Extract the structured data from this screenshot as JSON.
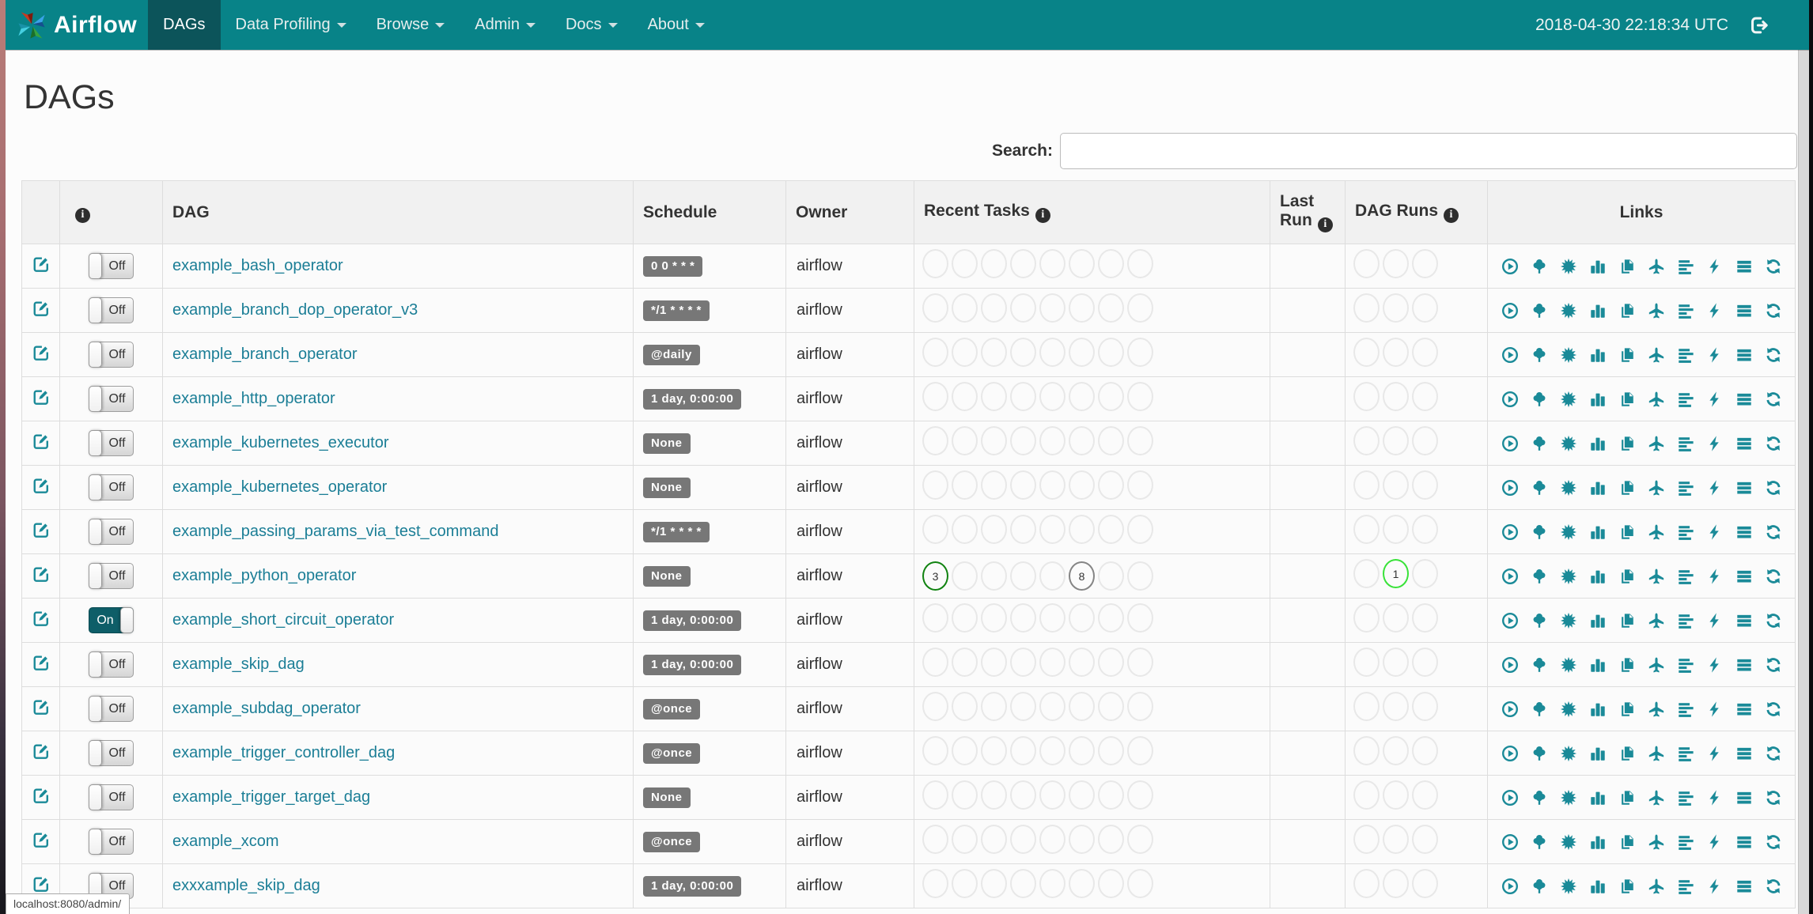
{
  "navbar": {
    "brand": "Airflow",
    "menu": [
      {
        "label": "DAGs",
        "active": true,
        "caret": false
      },
      {
        "label": "Data Profiling",
        "active": false,
        "caret": true
      },
      {
        "label": "Browse",
        "active": false,
        "caret": true
      },
      {
        "label": "Admin",
        "active": false,
        "caret": true
      },
      {
        "label": "Docs",
        "active": false,
        "caret": true
      },
      {
        "label": "About",
        "active": false,
        "caret": true
      }
    ],
    "clock": "2018-04-30 22:18:34 UTC"
  },
  "page": {
    "title": "DAGs",
    "search_label": "Search:",
    "search_value": "",
    "status_bar_url": "localhost:8080/admin/"
  },
  "table": {
    "headers": [
      {
        "label": "",
        "info": false
      },
      {
        "label": "",
        "info": true
      },
      {
        "label": "DAG",
        "info": false
      },
      {
        "label": "Schedule",
        "info": false
      },
      {
        "label": "Owner",
        "info": false
      },
      {
        "label": "Recent Tasks",
        "info": true
      },
      {
        "label": "Last Run",
        "info": true
      },
      {
        "label": "DAG Runs",
        "info": true
      },
      {
        "label": "Links",
        "info": false
      }
    ],
    "recent_task_slots": 8,
    "dag_run_slots": 3,
    "link_icons": [
      "trigger-dag",
      "tree-view",
      "graph-view",
      "task-duration",
      "task-tries",
      "landing-times",
      "gantt-view",
      "code-view",
      "logs",
      "refresh"
    ],
    "rows": [
      {
        "name": "example_bash_operator",
        "toggle": "Off",
        "schedule": "0 0 * * *",
        "owner": "airflow",
        "recent_tasks": [],
        "dag_runs": []
      },
      {
        "name": "example_branch_dop_operator_v3",
        "toggle": "Off",
        "schedule": "*/1 * * * *",
        "owner": "airflow",
        "recent_tasks": [],
        "dag_runs": []
      },
      {
        "name": "example_branch_operator",
        "toggle": "Off",
        "schedule": "@daily",
        "owner": "airflow",
        "recent_tasks": [],
        "dag_runs": []
      },
      {
        "name": "example_http_operator",
        "toggle": "Off",
        "schedule": "1 day, 0:00:00",
        "owner": "airflow",
        "recent_tasks": [],
        "dag_runs": []
      },
      {
        "name": "example_kubernetes_executor",
        "toggle": "Off",
        "schedule": "None",
        "owner": "airflow",
        "recent_tasks": [],
        "dag_runs": []
      },
      {
        "name": "example_kubernetes_operator",
        "toggle": "Off",
        "schedule": "None",
        "owner": "airflow",
        "recent_tasks": [],
        "dag_runs": []
      },
      {
        "name": "example_passing_params_via_test_command",
        "toggle": "Off",
        "schedule": "*/1 * * * *",
        "owner": "airflow",
        "recent_tasks": [],
        "dag_runs": []
      },
      {
        "name": "example_python_operator",
        "toggle": "Off",
        "schedule": "None",
        "owner": "airflow",
        "recent_tasks": [
          {
            "slot": 1,
            "count": 3,
            "state": "success"
          },
          {
            "slot": 6,
            "count": 8,
            "state": "no_status"
          }
        ],
        "dag_runs": [
          {
            "slot": 2,
            "count": 1,
            "state": "running"
          }
        ]
      },
      {
        "name": "example_short_circuit_operator",
        "toggle": "On",
        "schedule": "1 day, 0:00:00",
        "owner": "airflow",
        "recent_tasks": [],
        "dag_runs": []
      },
      {
        "name": "example_skip_dag",
        "toggle": "Off",
        "schedule": "1 day, 0:00:00",
        "owner": "airflow",
        "recent_tasks": [],
        "dag_runs": []
      },
      {
        "name": "example_subdag_operator",
        "toggle": "Off",
        "schedule": "@once",
        "owner": "airflow",
        "recent_tasks": [],
        "dag_runs": []
      },
      {
        "name": "example_trigger_controller_dag",
        "toggle": "Off",
        "schedule": "@once",
        "owner": "airflow",
        "recent_tasks": [],
        "dag_runs": []
      },
      {
        "name": "example_trigger_target_dag",
        "toggle": "Off",
        "schedule": "None",
        "owner": "airflow",
        "recent_tasks": [],
        "dag_runs": []
      },
      {
        "name": "example_xcom",
        "toggle": "Off",
        "schedule": "@once",
        "owner": "airflow",
        "recent_tasks": [],
        "dag_runs": []
      },
      {
        "name": "exxxample_skip_dag",
        "toggle": "Off",
        "schedule": "1 day, 0:00:00",
        "owner": "airflow",
        "recent_tasks": [],
        "dag_runs": []
      }
    ]
  },
  "colors": {
    "navbar_teal": "#088388",
    "navbar_active": "#0c545a",
    "accent_teal": "#1a8a98",
    "link_teal": "#1b7e96",
    "badge_gray": "#777777",
    "state_success": "#118311",
    "state_running": "#39e239",
    "state_no_status": "#858585",
    "circle_empty": "#e8e8e8"
  }
}
